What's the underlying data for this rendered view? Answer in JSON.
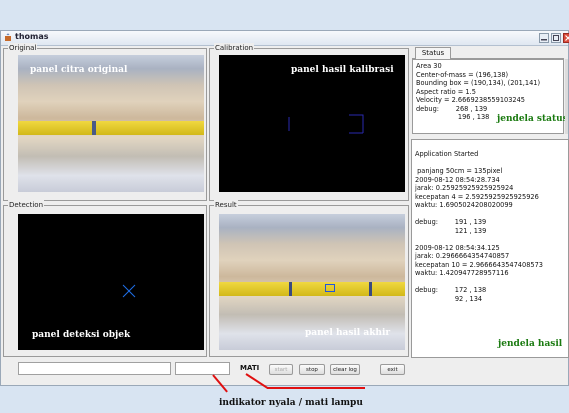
{
  "window": {
    "title": "thomas"
  },
  "panels": {
    "original": {
      "label": "Original",
      "caption": "panel citra original"
    },
    "calibration": {
      "label": "Calibration",
      "caption": "panel hasil kalibrasi"
    },
    "detection": {
      "label": "Detection",
      "caption": "panel deteksi objek"
    },
    "result": {
      "label": "Result",
      "caption": "panel hasil akhir"
    }
  },
  "status": {
    "tab": "Status",
    "lines": [
      "Area 30",
      "Center-of-mass = (196,138)",
      "Bounding box = (190,134), (201,141)",
      "Aspect ratio = 1.5",
      "Velocity = 2.6669238559103245",
      "debug:        268 , 139",
      "                    196 , 138"
    ],
    "annotation": "jendela status"
  },
  "log": {
    "lines": [
      "Application Started",
      "",
      " panjang 50cm = 135pixel",
      "2009-08-12 08:54:28.734",
      "jarak: 0.25925925925925924",
      "kecepatan 4 = 2.5925925925925926",
      "waktu: 1.6905024208020099",
      "",
      "debug:        191 , 139",
      "                   121 , 139",
      "",
      "2009-08-12 08:54:34.125",
      "jarak: 0.2966664354740857",
      "kecepatan 10 = 2.9666643547408573",
      "waktu: 1.420947728957116",
      "",
      "debug:        172 , 138",
      "                   92 , 134"
    ],
    "annotation": "jendela hasil"
  },
  "controls": {
    "lamp_status": "MATI",
    "start": "start",
    "stop": "stop",
    "clear_log": "clear log",
    "exit": "exit"
  },
  "annotations": {
    "lamp_indicator": "indikator nyala / mati lampu"
  },
  "colors": {
    "annotation_white": "#ffffff",
    "annotation_green": "#1a7a10",
    "pointer_red": "#e01010",
    "detection_mark": "#1e6ee6"
  }
}
